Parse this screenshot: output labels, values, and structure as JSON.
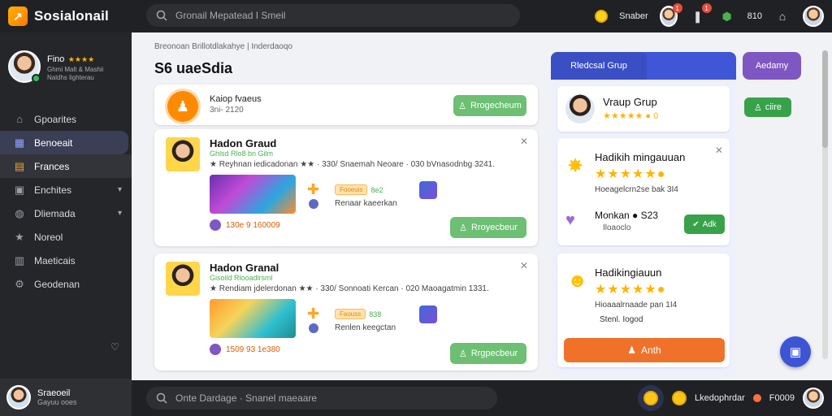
{
  "brand": {
    "name": "Sosialonail",
    "logo_glyph": "↗"
  },
  "search": {
    "placeholder": "Gronail Mepatead I Smeil"
  },
  "topbar": {
    "user_text": "Snaber",
    "badge_1": "1",
    "badge_2": "1",
    "count_text": "810"
  },
  "profile": {
    "name": "Fino",
    "stars": "★★★★",
    "line1": "Ghmi Malt & Mashii",
    "line2": "Naldhs lighterau"
  },
  "nav": [
    {
      "label": "Gpoarites",
      "icon": "home-icon"
    },
    {
      "label": "Benoeait",
      "icon": "grid-icon"
    },
    {
      "label": "Frances",
      "icon": "document-icon"
    },
    {
      "label": "Enchites",
      "icon": "folder-icon"
    },
    {
      "label": "Dliemada",
      "icon": "globe-icon"
    },
    {
      "label": "Noreol",
      "icon": "star-icon"
    },
    {
      "label": "Maeticais",
      "icon": "chart-icon"
    },
    {
      "label": "Geodenan",
      "icon": "gear-icon"
    }
  ],
  "sidebar_footer": {
    "name": "Sraeoeil",
    "sub": "Gayuu ooes"
  },
  "breadcrumb": "Breonoan Brillotdlakahye | Inderdaoqo",
  "page_title": "S6 uaeSdia",
  "top_card": {
    "title": "Kaiop fvaeus",
    "subtitle": "3ni- 2120",
    "button": "Rrogecheum"
  },
  "posts": [
    {
      "name": "Hadon Graud",
      "meta1": "Ghlsd Rlo8 bn Gilm",
      "meta2": "★ Reyhnan iedicadonan ★★ · 330/ Snaemah Neoare · 030 bVnasodnbg 3241.",
      "tag": "Fooeuis",
      "tag_count": "8e2",
      "note": "Renaar kaeerkan",
      "stat": "130e 9 160009",
      "button": "Rroyecbeur"
    },
    {
      "name": "Hadon Granal",
      "meta1": "Gisoild Rlooadlrsml",
      "meta2": "★ Rendiam jdelerdonan ★★ · 330/ Sonnoati Kercan · 020 Maoagatmin 1331.",
      "tag": "Faouss",
      "tag_count": "838",
      "note": "Renlen keegctan",
      "stat": "1509 93 1e380",
      "button": "Rrgpecbeur"
    }
  ],
  "right_panel": {
    "tab_group": "Rledcsal  Grup",
    "tab_other": "Aedamy",
    "top_title": "Vraup Grup",
    "top_stars": "★★★★★ ● 0",
    "card1_title": "Hadikih mingauuan",
    "card1_stars": "★★★★★●",
    "card1_sub": "Hoeagelcrn2se bak  3I4",
    "card1_user": "Monkan ● S23",
    "card1_user_sub": "Iloaoclo",
    "card1_button": "Adk",
    "card2_title": "Hadikingiauun",
    "card2_stars": "★★★★★●",
    "card2_sub": "Hioaaalrnaade pan  1I4",
    "card2_note": "Stenl. Iogod",
    "card2_button": "Anth"
  },
  "right_green_button": "ciire",
  "bottom": {
    "placeholder": "Onte Dardage · Snanel maeaare",
    "label": "Lkedophrdar",
    "count": "F0009"
  },
  "colors": {
    "accent_blue": "#3f57d6",
    "accent_purple": "#7e57c2",
    "green": "#6dbf73",
    "orange": "#f0722a",
    "dark": "#202124"
  }
}
